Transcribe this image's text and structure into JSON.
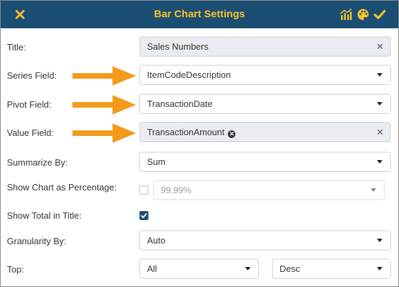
{
  "dialog": {
    "title": "Bar Chart Settings",
    "icons": {
      "close": "close-icon",
      "chart": "chart-icon",
      "palette": "palette-icon",
      "confirm": "check-icon"
    },
    "accent_color": "#f5c22a",
    "header_color": "#1b4e73",
    "arrow_color": "#f39a1b"
  },
  "form": {
    "title": {
      "label": "Title:",
      "value": "Sales Numbers"
    },
    "series_field": {
      "label": "Series Field:",
      "value": "ItemCodeDescription"
    },
    "pivot_field": {
      "label": "Pivot Field:",
      "value": "TransactionDate"
    },
    "value_field": {
      "label": "Value Field:",
      "value": "TransactionAmount"
    },
    "summarize_by": {
      "label": "Summarize By:",
      "value": "Sum"
    },
    "show_percentage": {
      "label": "Show Chart as Percentage:",
      "checked": false,
      "format": "99.99%"
    },
    "show_total": {
      "label": "Show Total in Title:",
      "checked": true
    },
    "granularity": {
      "label": "Granularity By:",
      "value": "Auto"
    },
    "top": {
      "label": "Top:",
      "count": "All",
      "order": "Desc"
    }
  }
}
